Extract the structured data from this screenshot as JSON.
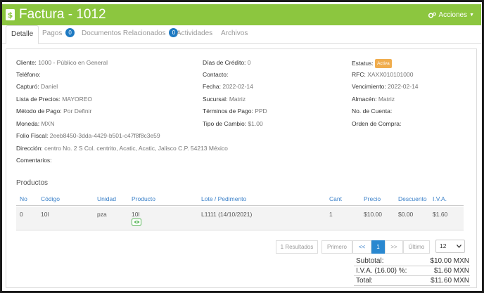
{
  "header": {
    "title": "Factura - 1012",
    "actions_label": "Acciones",
    "bar_color": "#8cc63f"
  },
  "tabs": [
    {
      "label": "Detalle",
      "badge": null
    },
    {
      "label": "Pagos",
      "badge": "0"
    },
    {
      "label": "Documentos Relacionados",
      "badge": "0"
    },
    {
      "label": "Actividades",
      "badge": null
    },
    {
      "label": "Archivos",
      "badge": null
    }
  ],
  "details": {
    "cliente": {
      "label": "Cliente:",
      "value": "1000 - Público en General"
    },
    "telefono": {
      "label": "Teléfono:",
      "value": ""
    },
    "capturo": {
      "label": "Capturó:",
      "value": "Daniel"
    },
    "lista_precios": {
      "label": "Lista de Precios:",
      "value": "MAYOREO"
    },
    "metodo_pago": {
      "label": "Método de Pago:",
      "value": "Por Definir"
    },
    "moneda": {
      "label": "Moneda:",
      "value": "MXN"
    },
    "folio_fiscal": {
      "label": "Folio Fiscal:",
      "value": "2eeb8450-3dda-4429-b501-c47f8f8c3e59"
    },
    "direccion": {
      "label": "Dirección:",
      "value": "centro No. 2 S Col. centrito, Acatic, Acatic, Jalisco C.P. 54213 México"
    },
    "comentarios": {
      "label": "Comentarios:",
      "value": ""
    },
    "dias_credito": {
      "label": "Días de Crédito:",
      "value": "0"
    },
    "contacto": {
      "label": "Contacto:",
      "value": ""
    },
    "fecha": {
      "label": "Fecha:",
      "value": "2022-02-14"
    },
    "sucursal": {
      "label": "Sucursal:",
      "value": "Matriz"
    },
    "terminos_pago": {
      "label": "Términos de Pago:",
      "value": "PPD"
    },
    "tipo_cambio": {
      "label": "Tipo de Cambio:",
      "value": "$1.00"
    },
    "estatus": {
      "label": "Estatus:",
      "value": "Activa"
    },
    "rfc": {
      "label": "RFC:",
      "value": "XAXX010101000"
    },
    "vencimiento": {
      "label": "Vencimiento:",
      "value": "2022-02-14"
    },
    "almacen": {
      "label": "Almacén:",
      "value": "Matriz"
    },
    "no_cuenta": {
      "label": "No. de Cuenta:",
      "value": ""
    },
    "orden_compra": {
      "label": "Orden de Compra:",
      "value": ""
    }
  },
  "products": {
    "title": "Productos",
    "columns": [
      "No",
      "Código",
      "Unidad",
      "Producto",
      "Lote / Pedimento",
      "Cant",
      "Precio",
      "Descuento",
      "I.V.A."
    ],
    "rows": [
      {
        "no": "0",
        "codigo": "10l",
        "unidad": "pza",
        "producto": "10l",
        "lote": "L1111 (14/10/2021)",
        "cant": "1",
        "precio": "$10.00",
        "descuento": "$0.00",
        "iva": "$1.60"
      }
    ]
  },
  "pagination": {
    "results": "1 Resultados",
    "first": "Primero",
    "prev": "<<",
    "current": "1",
    "next": ">>",
    "last": "Último",
    "page_size": "12"
  },
  "totals": {
    "subtotal_label": "Subtotal:",
    "subtotal_value": "$10.00 MXN",
    "iva_label": "I.V.A. (16.00) %:",
    "iva_value": "$1.60 MXN",
    "total_label": "Total:",
    "total_value": "$11.60 MXN"
  }
}
